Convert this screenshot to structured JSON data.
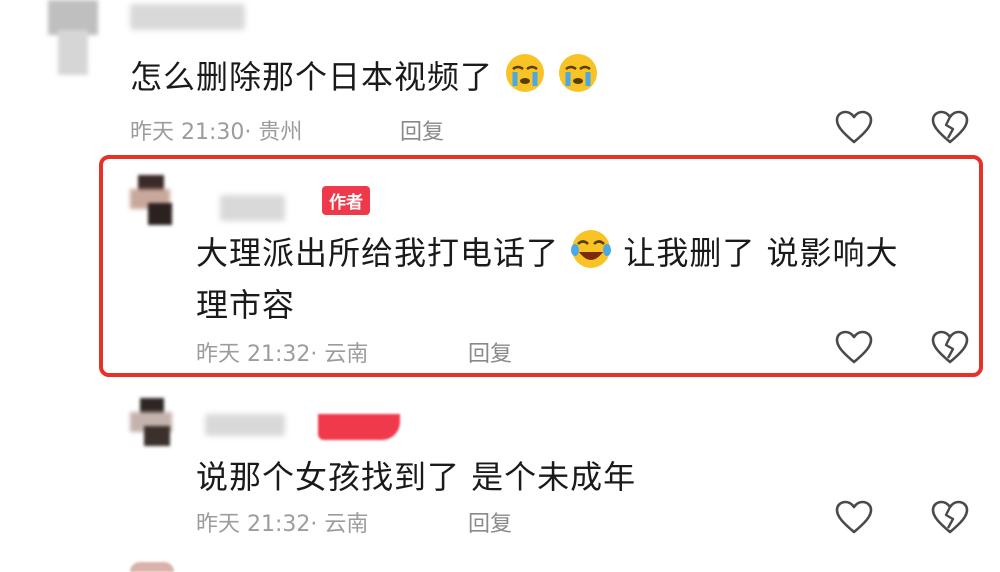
{
  "comments": [
    {
      "text": "怎么删除那个日本视频了",
      "emojis": [
        "crying-emoji",
        "crying-emoji"
      ],
      "time": "昨天 21:30",
      "location": "· 贵州",
      "reply_label": "回复"
    },
    {
      "author_badge": "作者",
      "text_line1": "大理派出所给我打电话了",
      "emoji": "laughing-tears-emoji",
      "text_line1_after": "让我删了 说影响大",
      "text_line2": "理市容",
      "time": "昨天 21:32",
      "location": "· 云南",
      "reply_label": "回复"
    },
    {
      "text": "说那个女孩找到了 是个未成年",
      "time": "昨天 21:32",
      "location": "· 云南",
      "reply_label": "回复"
    }
  ],
  "colors": {
    "highlight_border": "#e8302a",
    "author_badge": "#f0384b",
    "meta_text": "#9c9c9c"
  },
  "icons": [
    "heart-outline-icon",
    "broken-heart-icon"
  ]
}
